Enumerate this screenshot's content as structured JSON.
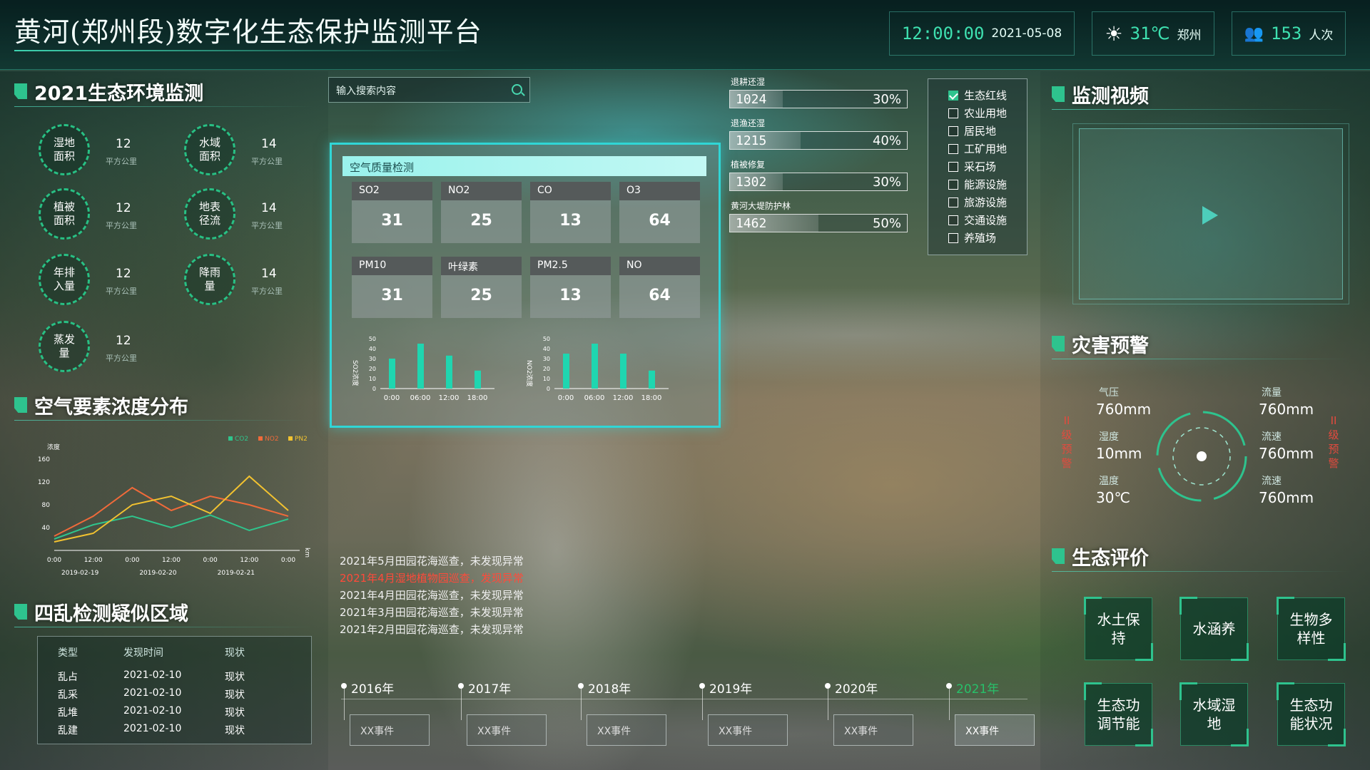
{
  "header": {
    "title": "黄河(郑州段)数字化生态保护监测平台",
    "time": "12:00:00",
    "date": "2021-05-08",
    "temp": "31℃",
    "city": "郑州",
    "visitors": "153",
    "visitors_unit": "人次"
  },
  "env": {
    "title": "2021生态环境监测",
    "items": [
      {
        "label": "湿地面积",
        "value": "12",
        "unit": "平方公里"
      },
      {
        "label": "水域面积",
        "value": "14",
        "unit": "平方公里"
      },
      {
        "label": "植被面积",
        "value": "12",
        "unit": "平方公里"
      },
      {
        "label": "地表径流",
        "value": "14",
        "unit": "平方公里"
      },
      {
        "label": "年排入量",
        "value": "12",
        "unit": "平方公里"
      },
      {
        "label": "降雨量",
        "value": "14",
        "unit": "平方公里"
      },
      {
        "label": "蒸发量",
        "value": "12",
        "unit": "平方公里"
      }
    ]
  },
  "airdist": {
    "title": "空气要素浓度分布",
    "ylabel": "浓度",
    "xunit": "km",
    "legend": [
      "CO2",
      "NO2",
      "PN2"
    ],
    "colors": [
      "#2fc48c",
      "#f06a3a",
      "#f2c230"
    ]
  },
  "chart_data": {
    "type": "line",
    "x": [
      "0:00",
      "12:00",
      "0:00",
      "12:00",
      "0:00",
      "12:00",
      "0:00"
    ],
    "dates": [
      "2019-02-19",
      "2019-02-20",
      "2019-02-21"
    ],
    "yticks": [
      "160",
      "120",
      "80",
      "40"
    ],
    "ylim": [
      0,
      160
    ],
    "series": [
      {
        "name": "CO2",
        "values": [
          20,
          45,
          60,
          40,
          62,
          35,
          55
        ]
      },
      {
        "name": "NO2",
        "values": [
          25,
          60,
          110,
          70,
          95,
          80,
          60
        ]
      },
      {
        "name": "PN2",
        "values": [
          15,
          30,
          80,
          95,
          65,
          130,
          70
        ]
      }
    ]
  },
  "region": {
    "title": "四乱检测疑似区域",
    "headers": [
      "类型",
      "发现时间",
      "现状"
    ],
    "rows": [
      [
        "乱占",
        "2021-02-10",
        "现状"
      ],
      [
        "乱采",
        "2021-02-10",
        "现状"
      ],
      [
        "乱堆",
        "2021-02-10",
        "现状"
      ],
      [
        "乱建",
        "2021-02-10",
        "现状"
      ]
    ]
  },
  "search": {
    "placeholder": "输入搜索内容"
  },
  "aq": {
    "title": "空气质量检测",
    "cells": [
      {
        "label": "SO2",
        "value": "31"
      },
      {
        "label": "NO2",
        "value": "25"
      },
      {
        "label": "CO",
        "value": "13"
      },
      {
        "label": "O3",
        "value": "64"
      },
      {
        "label": "PM10",
        "value": "31"
      },
      {
        "label": "叶绿素",
        "value": "25"
      },
      {
        "label": "PM2.5",
        "value": "13"
      },
      {
        "label": "NO",
        "value": "64"
      }
    ],
    "mini": [
      {
        "ylabel": "SO2浓度",
        "values": [
          30,
          45,
          33,
          18
        ]
      },
      {
        "ylabel": "NO2浓度",
        "values": [
          35,
          45,
          35,
          18
        ]
      }
    ],
    "mini_x": [
      "0:00",
      "06:00",
      "12:00",
      "18:00"
    ],
    "mini_y": [
      "50",
      "40",
      "30",
      "20",
      "10",
      "0"
    ]
  },
  "progress": [
    {
      "label": "退耕还湿",
      "value": "1024",
      "pct": "30%"
    },
    {
      "label": "退渔还湿",
      "value": "1215",
      "pct": "40%"
    },
    {
      "label": "植被修复",
      "value": "1302",
      "pct": "30%"
    },
    {
      "label": "黄河大堤防护林",
      "value": "1462",
      "pct": "50%"
    }
  ],
  "layers": [
    {
      "label": "生态红线",
      "checked": true
    },
    {
      "label": "农业用地"
    },
    {
      "label": "居民地"
    },
    {
      "label": "工矿用地"
    },
    {
      "label": "采石场"
    },
    {
      "label": "能源设施"
    },
    {
      "label": "旅游设施"
    },
    {
      "label": "交通设施"
    },
    {
      "label": "养殖场"
    }
  ],
  "video": {
    "title": "监测视频"
  },
  "warning": {
    "title": "灾害预警",
    "side": "II级预警",
    "items": [
      {
        "label": "气压",
        "value": "760mm"
      },
      {
        "label": "流量",
        "value": "760mm"
      },
      {
        "label": "湿度",
        "value": "10mm"
      },
      {
        "label": "流速",
        "value": "760mm"
      },
      {
        "label": "温度",
        "value": "30℃"
      },
      {
        "label": "流速",
        "value": "760mm"
      }
    ]
  },
  "eco": {
    "title": "生态评价",
    "items": [
      "水土保持",
      "水涵养",
      "生物多样性",
      "生态功调节能",
      "水域湿地",
      "生态功能状况"
    ]
  },
  "events": [
    "2021年5月田园花海巡查，未发现异常",
    "2021年4月湿地植物园巡查，发现异常",
    "2021年4月田园花海巡查，未发现异常",
    "2021年3月田园花海巡查，未发现异常",
    "2021年2月田园花海巡查，未发现异常"
  ],
  "timeline": {
    "years": [
      "2016年",
      "2017年",
      "2018年",
      "2019年",
      "2020年",
      "2021年"
    ],
    "event": "XX事件"
  }
}
